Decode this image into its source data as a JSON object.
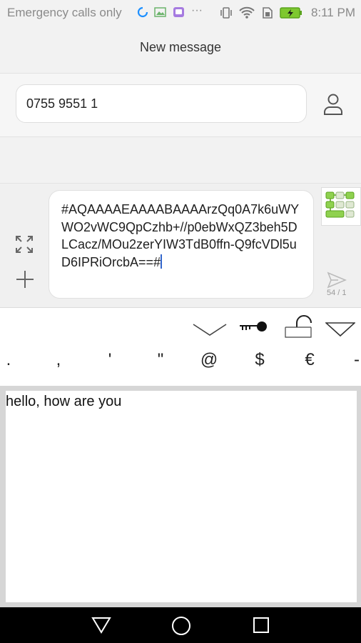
{
  "status_bar": {
    "carrier_text": "Emergency calls only",
    "time": "8:11 PM",
    "icons": [
      "sync-icon",
      "image-icon",
      "app-icon",
      "more-dots-icon",
      "vibrate-icon",
      "wifi-icon",
      "sim-icon",
      "battery-charging-icon"
    ]
  },
  "header": {
    "title": "New message"
  },
  "recipient": {
    "value": "0755 9551 1",
    "icon": "contact-icon"
  },
  "compose": {
    "message_text": "#AQAAAAEAAAABAAAArzQq0A7k6uWYWO2vWC9QpCzhb+//p0ebWxQZ3beh5DLCacz/MOu2zerYIW3TdB0ffn-Q9fcVDl5uD6IPRiOrcbA==#",
    "char_count": "54 / 1",
    "icons": [
      "expand-icon",
      "add-icon",
      "app-grid-icon",
      "send-icon"
    ]
  },
  "keyboard": {
    "toolbar_icons": [
      "chevron-down-icon",
      "key-icon",
      "unlock-icon",
      "triangle-down-icon"
    ],
    "symbols": [
      ".",
      ",",
      "'",
      "\"",
      "@",
      "$",
      "€",
      "-"
    ]
  },
  "input_panel": {
    "text": "hello, how are you"
  },
  "nav_bar": {
    "icons": [
      "back-icon",
      "home-icon",
      "recents-icon"
    ]
  }
}
